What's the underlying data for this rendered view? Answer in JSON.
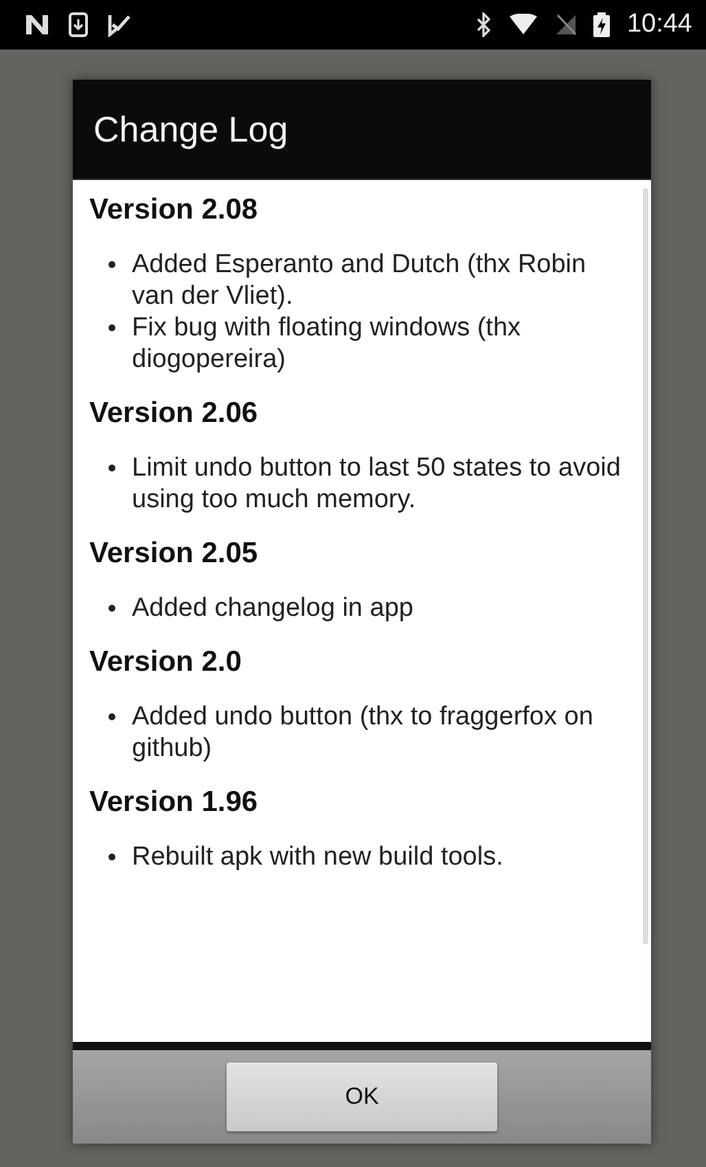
{
  "status_bar": {
    "time": "10:44"
  },
  "dialog": {
    "title": "Change Log",
    "sections": [
      {
        "heading": "Version 2.08",
        "items": [
          "Added Esperanto and Dutch (thx Robin van der Vliet).",
          "Fix bug with floating windows (thx diogopereira)"
        ]
      },
      {
        "heading": "Version 2.06",
        "items": [
          "Limit undo button to last 50 states to avoid using too much memory."
        ]
      },
      {
        "heading": "Version 2.05",
        "items": [
          "Added changelog in app"
        ]
      },
      {
        "heading": "Version 2.0",
        "items": [
          "Added undo button (thx to fraggerfox on github)"
        ]
      },
      {
        "heading": "Version 1.96",
        "items": [
          "Rebuilt apk with new build tools."
        ]
      }
    ],
    "button": "OK"
  }
}
